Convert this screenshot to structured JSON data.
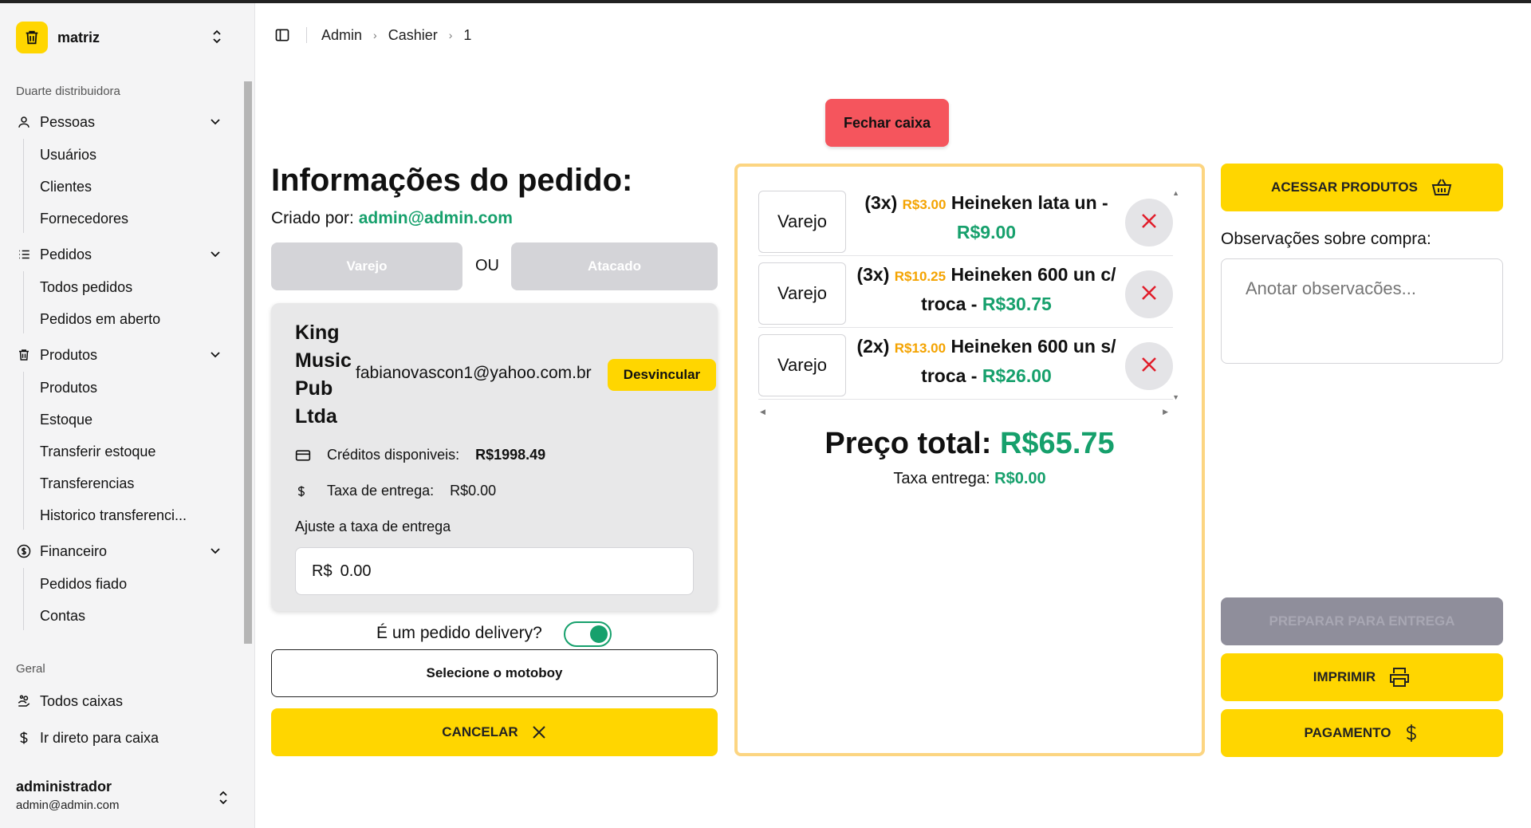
{
  "sidebar": {
    "brand": {
      "name": "matriz"
    },
    "org_label": "Duarte distribuidora",
    "sections": {
      "pessoas": {
        "label": "Pessoas",
        "items": [
          "Usuários",
          "Clientes",
          "Fornecedores"
        ]
      },
      "pedidos": {
        "label": "Pedidos",
        "items": [
          "Todos pedidos",
          "Pedidos em aberto"
        ]
      },
      "produtos": {
        "label": "Produtos",
        "items": [
          "Produtos",
          "Estoque",
          "Transferir estoque",
          "Transferencias",
          "Historico transferenci..."
        ]
      },
      "financeiro": {
        "label": "Financeiro",
        "items": [
          "Pedidos fiado",
          "Contas"
        ]
      }
    },
    "geral_label": "Geral",
    "geral_items": [
      "Todos caixas",
      "Ir direto para caixa"
    ],
    "user": {
      "name": "administrador",
      "email": "admin@admin.com"
    }
  },
  "header": {
    "breadcrumb": [
      "Admin",
      "Cashier",
      "1"
    ]
  },
  "actions": {
    "fechar_caixa": "Fechar caixa"
  },
  "order": {
    "title": "Informações do pedido:",
    "created_by_label": "Criado por:",
    "created_by_email": "admin@admin.com",
    "varejo_label": "Varejo",
    "ou_label": "OU",
    "atacado_label": "Atacado",
    "client": {
      "name_lines": [
        "King",
        "Music",
        "Pub",
        "Ltda"
      ],
      "email": "fabianovascon1@yahoo.com.br",
      "unlink_label": "Desvincular",
      "credits_label": "Créditos disponiveis:",
      "credits_value": "R$1998.49",
      "fee_label": "Taxa de entrega:",
      "fee_value": "R$0.00",
      "adjust_label": "Ajuste a taxa de entrega",
      "fee_prefix": "R$",
      "fee_input_value": "0.00"
    },
    "delivery_question": "É um pedido delivery?",
    "delivery_on": true,
    "motoboy_label": "Selecione o motoboy",
    "cancel_label": "CANCELAR"
  },
  "cart": {
    "items": [
      {
        "type": "Varejo",
        "qty": "(3x)",
        "unit_price": "R$3.00",
        "name": "Heineken lata un -",
        "subtotal": "R$9.00"
      },
      {
        "type": "Varejo",
        "qty": "(3x)",
        "unit_price": "R$10.25",
        "name": "Heineken 600 un c/ troca -",
        "subtotal": "R$30.75"
      },
      {
        "type": "Varejo",
        "qty": "(2x)",
        "unit_price": "R$13.00",
        "name": "Heineken 600 un s/ troca -",
        "subtotal": "R$26.00"
      }
    ],
    "total_label": "Preço total:",
    "total_value": "R$65.75",
    "fee_label": "Taxa entrega:",
    "fee_value": "R$0.00"
  },
  "right": {
    "access_products": "ACESSAR PRODUTOS",
    "obs_label": "Observações sobre compra:",
    "obs_placeholder": "Anotar observacões...",
    "prepare_label": "PREPARAR PARA ENTREGA",
    "print_label": "IMPRIMIR",
    "payment_label": "PAGAMENTO"
  },
  "colors": {
    "accent_yellow": "#FFD600",
    "danger": "#F5555D",
    "money_green": "#16a06c",
    "unit_price_orange": "#F4A300",
    "cart_border": "#FCD581"
  }
}
